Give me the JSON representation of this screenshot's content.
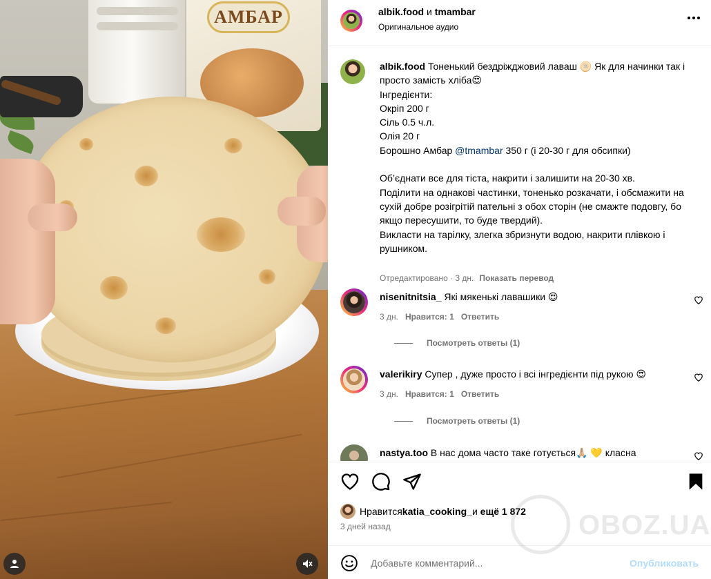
{
  "media": {
    "bag_brand": "АМБАР"
  },
  "header": {
    "user1": "albik.food",
    "connector": " и ",
    "user2": "tmambar",
    "audio": "Оригинальное аудио"
  },
  "caption": {
    "username": "albik.food",
    "text_intro": " Тоненький бездріжджовий лаваш 🫓 Як для начинки так і просто замість хліба😍\nІнгредієнти:\nОкріп 200 г\nСіль 0.5 ч.л.\nОлія 20 г\nБорошно Амбар ",
    "mention": "@tmambar",
    "text_rest": " 350 г (і 20-30 г для обсипки)\n\nОб’єднати все для тіста, накрити і залишити на 20-30 хв.\nПоділити на однакові частинки, тоненько розкачати, і обсмажити на сухій добре розігрітій пательні з обох сторін (не смажте подовгу, бо якщо пересушити, то буде твердий).\nВикласти на тарілку, злегка збризнути водою, накрити плівкою і рушником.",
    "edited": "Отредактировано · 3 дн.",
    "translate": "Показать перевод"
  },
  "comments": [
    {
      "username": "nisenitnitsia_",
      "text": " Які мякенькі лавашики 😍",
      "time": "3 дн.",
      "likes": "Нравится: 1",
      "reply": "Ответить",
      "view_replies": "Посмотреть ответы (1)"
    },
    {
      "username": "valerikiry",
      "text": " Супер , дуже просто і всі інгредієнти під рукою 😍",
      "time": "3 дн.",
      "likes": "Нравится: 1",
      "reply": "Ответить",
      "view_replies": "Посмотреть ответы (1)"
    },
    {
      "username": "nastya.too",
      "text": " В нас дома часто таке готується🙏🏼 💛 класна"
    }
  ],
  "likes": {
    "prefix": "Нравится ",
    "user": "katia_cooking_",
    "middle": " и ",
    "more": "ещё 1 872"
  },
  "date": "3 дней назад",
  "comment_input": {
    "placeholder": "Добавьте комментарий...",
    "post": "Опубликовать"
  },
  "watermark": "OBOZ.UA",
  "colors": {
    "link": "#00376b",
    "muted": "#737373",
    "post_disabled": "#b3dbff"
  }
}
